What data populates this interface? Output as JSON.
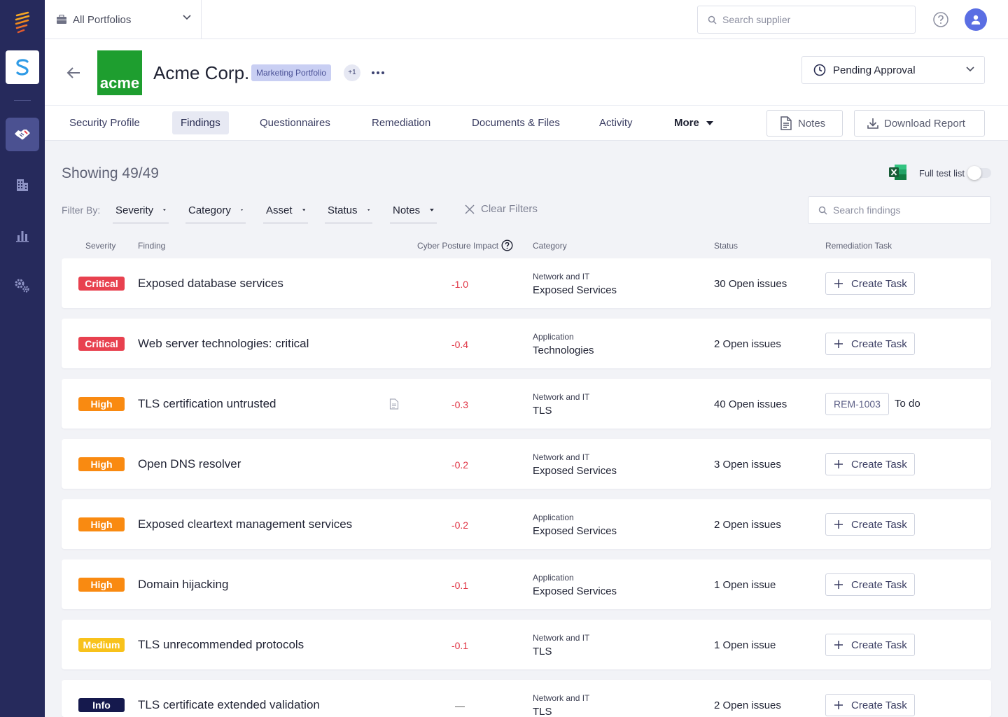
{
  "topbar": {
    "portfolio_label": "All Portfolios",
    "search_placeholder": "Search supplier"
  },
  "header": {
    "company_name": "Acme Corp.",
    "logo_text": "acme",
    "logo_color": "#1e9e2f",
    "portfolio_tag": "Marketing Portfolio",
    "extra_portfolios": "+1",
    "status": "Pending Approval"
  },
  "tabs": [
    {
      "label": "Security Profile",
      "active": false
    },
    {
      "label": "Findings",
      "active": true
    },
    {
      "label": "Questionnaires",
      "active": false
    },
    {
      "label": "Remediation",
      "active": false
    },
    {
      "label": "Documents & Files",
      "active": false
    },
    {
      "label": "Activity",
      "active": false
    },
    {
      "label": "More",
      "active": false
    }
  ],
  "actions": {
    "notes": "Notes",
    "download": "Download Report"
  },
  "findings_view": {
    "showing": "Showing 49/49",
    "full_test_list": "Full test list",
    "full_test_list_on": false,
    "filter_by": "Filter By:",
    "filters": [
      "Severity",
      "Category",
      "Asset",
      "Status",
      "Notes"
    ],
    "clear_filters": "Clear Filters",
    "search_placeholder": "Search findings"
  },
  "columns": {
    "severity": "Severity",
    "finding": "Finding",
    "impact": "Cyber Posture Impact",
    "category": "Category",
    "status": "Status",
    "remediation": "Remediation Task"
  },
  "create_task_label": "Create Task",
  "rows": [
    {
      "severity": "Critical",
      "finding": "Exposed database services",
      "impact": "-1.0",
      "cat_top": "Network and IT",
      "cat_bottom": "Exposed Services",
      "status": "30 Open issues"
    },
    {
      "severity": "Critical",
      "finding": "Web server technologies: critical",
      "impact": "-0.4",
      "cat_top": "Application",
      "cat_bottom": "Technologies",
      "status": "2 Open issues"
    },
    {
      "severity": "High",
      "finding": "TLS certification untrusted",
      "impact": "-0.3",
      "cat_top": "Network and IT",
      "cat_bottom": "TLS",
      "status": "40 Open issues",
      "has_note": true,
      "task_id": "REM-1003",
      "task_status": "To do"
    },
    {
      "severity": "High",
      "finding": "Open DNS resolver",
      "impact": "-0.2",
      "cat_top": "Network and IT",
      "cat_bottom": "Exposed Services",
      "status": "3 Open issues"
    },
    {
      "severity": "High",
      "finding": "Exposed cleartext management services",
      "impact": "-0.2",
      "cat_top": "Application",
      "cat_bottom": "Exposed Services",
      "status": "2 Open issues"
    },
    {
      "severity": "High",
      "finding": "Domain hijacking",
      "impact": "-0.1",
      "cat_top": "Application",
      "cat_bottom": "Exposed Services",
      "status": "1 Open issue"
    },
    {
      "severity": "Medium",
      "finding": "TLS unrecommended protocols",
      "impact": "-0.1",
      "cat_top": "Network and IT",
      "cat_bottom": "TLS",
      "status": "1 Open issue"
    },
    {
      "severity": "Info",
      "finding": "TLS certificate extended validation",
      "impact": "—",
      "cat_top": "Network and IT",
      "cat_bottom": "TLS",
      "status": "2 Open issues"
    }
  ],
  "colors": {
    "sidebar": "#262a5c",
    "critical": "#e8414f",
    "high": "#f98a11",
    "medium": "#f8c21b",
    "info": "#15194d",
    "negative_impact": "#e03545"
  },
  "icons": [
    "brand-logo-icon",
    "app-s-icon",
    "handshake-icon",
    "building-icon",
    "bar-chart-icon",
    "settings-icon",
    "briefcase-icon",
    "search-icon",
    "help-icon",
    "user-icon",
    "back-arrow-icon",
    "more-dots-icon",
    "clock-icon",
    "document-icon",
    "download-icon",
    "excel-icon",
    "close-icon",
    "plus-icon",
    "note-icon"
  ]
}
